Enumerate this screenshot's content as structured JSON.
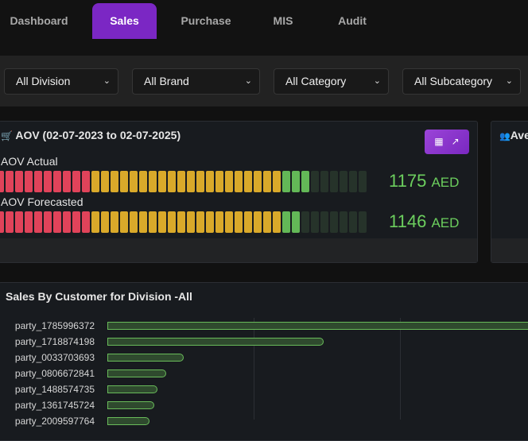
{
  "nav": {
    "tabs": [
      {
        "label": "Dashboard",
        "active": false
      },
      {
        "label": "Sales",
        "active": true
      },
      {
        "label": "Purchase",
        "active": false
      },
      {
        "label": "MIS",
        "active": false
      },
      {
        "label": "Audit",
        "active": false
      }
    ]
  },
  "filters": [
    "All Division",
    "All Brand",
    "All Category",
    "All Subcategory"
  ],
  "aov": {
    "title": "AOV (02-07-2023 to 02-07-2025)",
    "icon": "cart-icon",
    "button_icons": [
      "table-icon",
      "expand-icon"
    ],
    "colors": {
      "red": "#e0435a",
      "yellow": "#d9a92a",
      "green": "#63b857",
      "empty": "#26332a"
    },
    "rows": [
      {
        "label": "AOV Actual",
        "value": "1175",
        "unit": "AED",
        "segments": {
          "red": 10,
          "yellow": 20,
          "green": 3,
          "empty": 6
        }
      },
      {
        "label": "AOV Forecasted",
        "value": "1146",
        "unit": "AED",
        "segments": {
          "red": 10,
          "yellow": 20,
          "green": 2,
          "empty": 7
        }
      }
    ]
  },
  "side_panel": {
    "title_partial": "Ave",
    "icon": "users-icon"
  },
  "chart_data": {
    "type": "bar",
    "orientation": "horizontal",
    "title": "Sales By Customer for Division -All",
    "categories": [
      "party_1785996372",
      "party_1718874198",
      "party_0033703693",
      "party_0806672841",
      "party_1488574735",
      "party_1361745724",
      "party_2009597764"
    ],
    "values": [
      290,
      148,
      52,
      40,
      34,
      32,
      29
    ],
    "bar_color": "#69bb5a",
    "grid": true
  }
}
